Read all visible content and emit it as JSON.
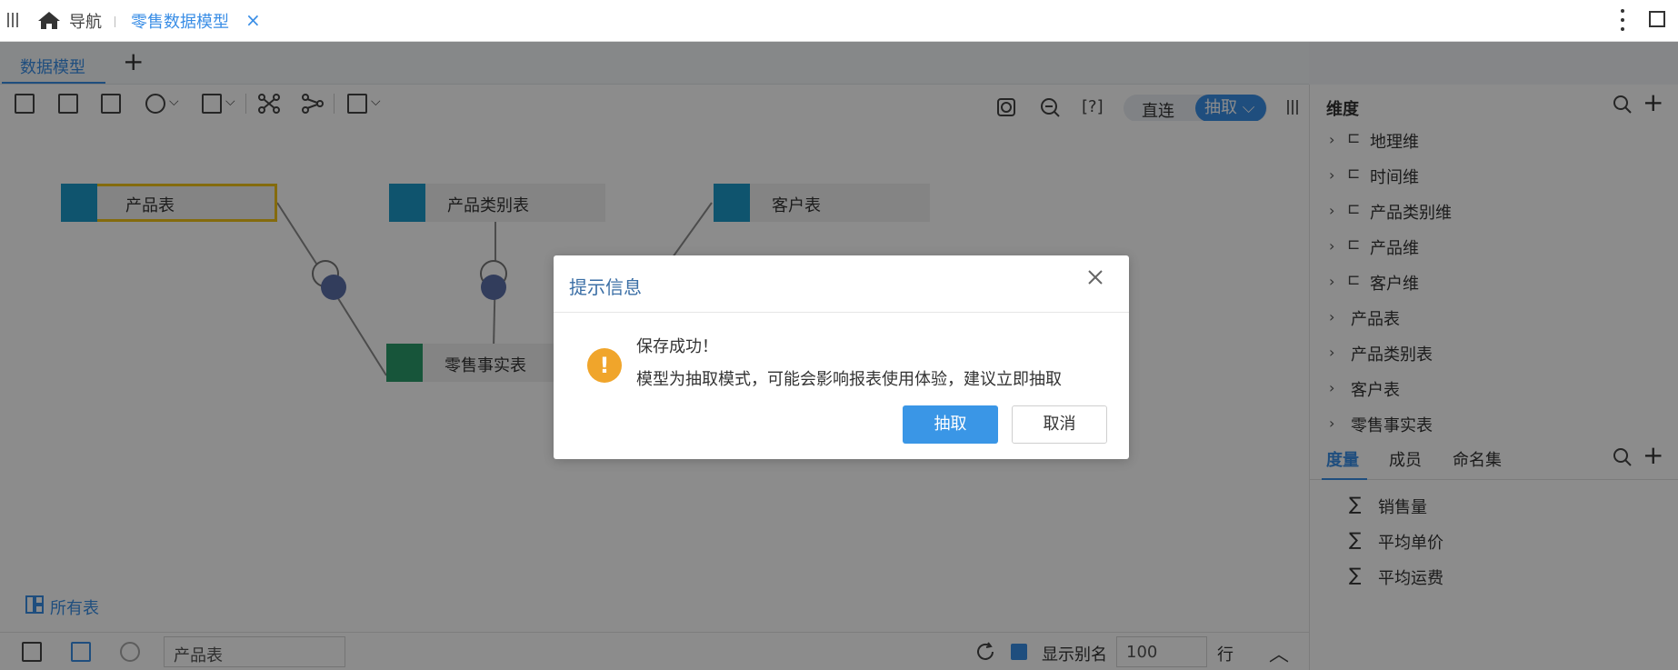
{
  "topbar": {
    "nav_label": "导航",
    "tab_title": "零售数据模型",
    "tab_close": "×"
  },
  "subtabs": {
    "active": "数据模型",
    "add": "+"
  },
  "toolbar": {
    "help": "[?]",
    "mode_direct": "直连",
    "mode_extract": "抽取"
  },
  "canvas": {
    "tables": [
      "产品表",
      "产品类别表",
      "客户表",
      "零售事实表"
    ],
    "all_tables": "所有表"
  },
  "bottombar": {
    "search_value": "产品表",
    "show_alias": "显示别名",
    "rows_value": "100",
    "rows_unit": "行"
  },
  "right_panel": {
    "dimensions_title": "维度",
    "dimensions": [
      "地理维",
      "时间维",
      "产品类别维",
      "产品维",
      "客户维"
    ],
    "tables": [
      "产品表",
      "产品类别表",
      "客户表",
      "零售事实表"
    ],
    "measure_tabs": [
      "度量",
      "成员",
      "命名集"
    ],
    "measures": [
      "销售量",
      "平均单价",
      "平均运费"
    ]
  },
  "dialog": {
    "title": "提示信息",
    "line1": "保存成功！",
    "line2": "模型为抽取模式，可能会影响报表使用体验，建议立即抽取",
    "confirm": "抽取",
    "cancel": "取消"
  },
  "colors": {
    "accent": "#3a8ee6",
    "warning": "#f0a52b",
    "table_icon": "#1c9ac9",
    "fact_icon": "#2a9b6a"
  }
}
